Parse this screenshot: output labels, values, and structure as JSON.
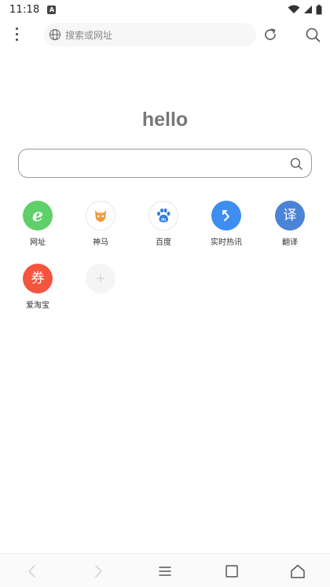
{
  "status_bar": {
    "time": "11:18",
    "app_icon": "A"
  },
  "toolbar": {
    "address_placeholder": "搜索或网址"
  },
  "logo": {
    "text": "hello"
  },
  "main_search": {
    "value": ""
  },
  "quick_links": [
    {
      "label": "网址",
      "icon": "e-icon",
      "glyph": "e",
      "color": "#5fcf68"
    },
    {
      "label": "神马",
      "icon": "shenma-icon",
      "glyph": "",
      "color": "#f29a3a"
    },
    {
      "label": "百度",
      "icon": "baidu-paw-icon",
      "glyph": "",
      "color": "#2f7de1"
    },
    {
      "label": "实时热讯",
      "icon": "arrow-icon",
      "glyph": "",
      "color": "#3d8ef0"
    },
    {
      "label": "翻译",
      "icon": "translate-icon",
      "glyph": "译",
      "color": "#4b84d6"
    },
    {
      "label": "爱淘宝",
      "icon": "coupon-icon",
      "glyph": "券",
      "color": "#f3553f"
    },
    {
      "label": "",
      "icon": "add-icon",
      "glyph": "+",
      "color": "#f5f5f5"
    }
  ],
  "colors": {
    "accent": "#3d8ef0",
    "nav_disabled": "#c9c9c9",
    "nav_active": "#555555"
  },
  "icons": {
    "menu": "more-vertical-icon",
    "globe": "globe-icon",
    "refresh": "refresh-icon",
    "search": "search-icon",
    "back": "back-icon",
    "forward": "forward-icon",
    "tabs_menu": "hamburger-icon",
    "windows": "square-icon",
    "home": "home-icon"
  }
}
